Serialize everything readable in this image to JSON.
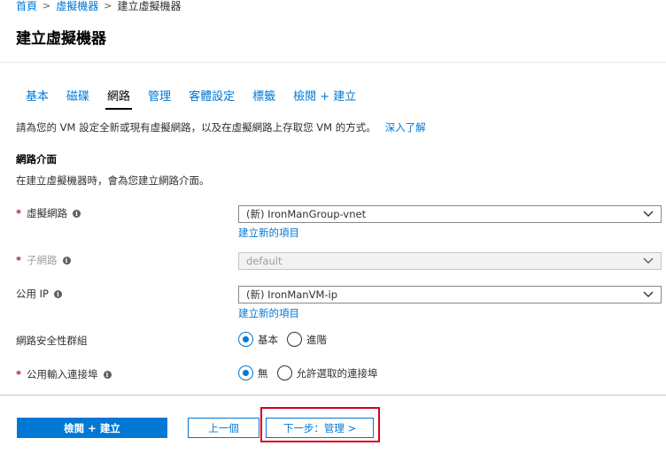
{
  "breadcrumb": [
    {
      "label": "首頁"
    },
    {
      "label": "虛擬機器"
    },
    {
      "label": "建立虛擬機器"
    }
  ],
  "page": {
    "title": "建立虛擬機器"
  },
  "tabs": [
    {
      "label": "基本",
      "active": false
    },
    {
      "label": "磁碟",
      "active": false
    },
    {
      "label": "網路",
      "active": true
    },
    {
      "label": "管理",
      "active": false
    },
    {
      "label": "客體設定",
      "active": false
    },
    {
      "label": "標籤",
      "active": false
    },
    {
      "label": "檢閱 + 建立",
      "active": false
    }
  ],
  "intro": {
    "text": "請為您的 VM 設定全新或現有虛擬網路，以及在虛擬網路上存取您 VM 的方式。",
    "learn_more": "深入了解"
  },
  "network_interface": {
    "title": "網路介面",
    "description": "在建立虛擬機器時，會為您建立網路介面。"
  },
  "fields": {
    "vnet": {
      "label": "虛擬網路",
      "value": "(新) IronManGroup-vnet",
      "create_link": "建立新的項目"
    },
    "subnet": {
      "label": "子網路",
      "value": "default"
    },
    "public_ip": {
      "label": "公用 IP",
      "value": "(新) IronManVM-ip",
      "create_link": "建立新的項目"
    },
    "nsg": {
      "label": "網路安全性群組",
      "options": [
        "基本",
        "進階"
      ],
      "selected": "基本"
    },
    "inbound_ports": {
      "label": "公用輸入連接埠",
      "options": [
        "無",
        "允許選取的連接埠"
      ],
      "selected": "無"
    }
  },
  "footer": {
    "review_create": "檢閱 + 建立",
    "previous": "上一個",
    "next": "下一步：管理 >"
  },
  "colors": {
    "accent": "#0078d4",
    "highlight": "#d9001b",
    "required": "#a4262c"
  }
}
